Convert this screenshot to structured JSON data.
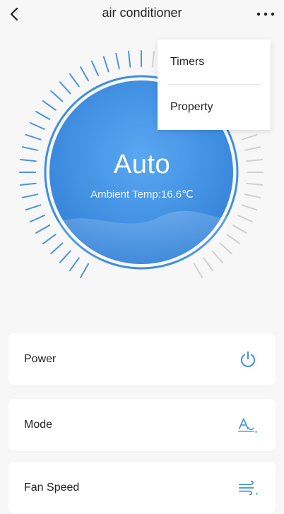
{
  "header": {
    "title": "air conditioner",
    "back_icon": "chevron-left-icon",
    "more_icon": "more-horizontal-icon"
  },
  "dial": {
    "mode": "Auto",
    "ambient": "Ambient Temp:16.6℃",
    "accent_color": "#3f8ee0"
  },
  "menu": {
    "items": [
      {
        "label": "Timers"
      },
      {
        "label": "Property"
      }
    ]
  },
  "controls": [
    {
      "label": "Power",
      "icon": "power-icon"
    },
    {
      "label": "Mode",
      "icon": "mode-a-icon"
    },
    {
      "label": "Fan Speed",
      "icon": "wind-icon"
    }
  ],
  "colors": {
    "icon_blue": "#3b8fe0",
    "tick_blue": "#4a93e0",
    "tick_gray": "#d0d0d0",
    "background": "#f7f7f7"
  }
}
